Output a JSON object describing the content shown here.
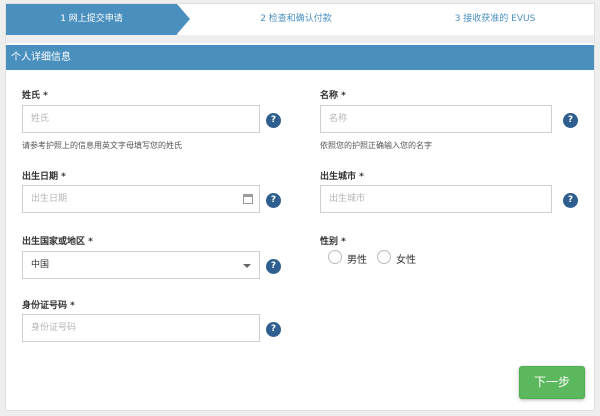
{
  "steps": [
    {
      "label": "1  网上提交申请"
    },
    {
      "label": "2  检查和确认付款"
    },
    {
      "label": "3  接收获准的 EVUS"
    }
  ],
  "section": {
    "title": "个人详细信息"
  },
  "fields": {
    "surname": {
      "label": "姓氏 *",
      "placeholder": "姓氏",
      "hint": "请参考护照上的信息用英文字母填写您的姓氏"
    },
    "given_name": {
      "label": "名称 *",
      "placeholder": "名称",
      "hint": "依照您的护照正确输入您的名字"
    },
    "birth_date": {
      "label": "出生日期 *",
      "placeholder": "出生日期"
    },
    "birth_city": {
      "label": "出生城市 *",
      "placeholder": "出生城市"
    },
    "birth_country": {
      "label": "出生国家或地区 *",
      "value": "中国"
    },
    "gender": {
      "label": "性别 *",
      "options": [
        "男性",
        "女性"
      ]
    },
    "id_number": {
      "label": "身份证号码 *",
      "placeholder": "身份证号码"
    }
  },
  "help_glyph": "?",
  "actions": {
    "next_label": "下一步"
  },
  "colors": {
    "primary": "#4a90bf",
    "help": "#2f5f8f",
    "success": "#5cb85c"
  }
}
